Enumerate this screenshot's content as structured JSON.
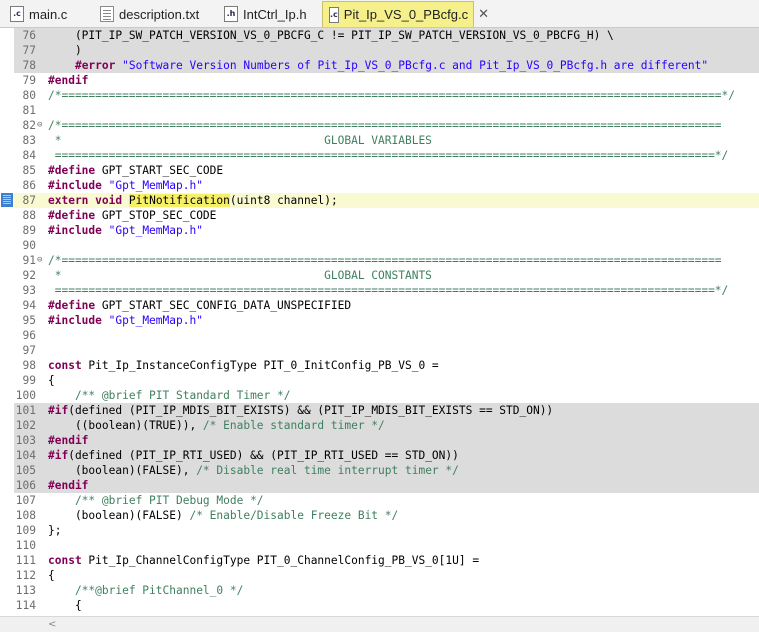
{
  "tabs": [
    {
      "label": "main.c",
      "icon": "c-file-icon",
      "active": false
    },
    {
      "label": "description.txt",
      "icon": "text-file-icon",
      "active": false
    },
    {
      "label": "IntCtrl_Ip.h",
      "icon": "h-file-icon",
      "active": false
    },
    {
      "label": "Pit_Ip_VS_0_PBcfg.c",
      "icon": "c-file-icon",
      "active": true
    }
  ],
  "close_label": "✕",
  "lines": [
    {
      "n": "76",
      "segs": [
        [
          "",
          "    (PIT_IP_SW_PATCH_VERSION_VS_0_PBCFG_C != PIT_IP_SW_PATCH_VERSION_VS_0_PBCFG_H) \\"
        ]
      ],
      "inactive": true
    },
    {
      "n": "77",
      "segs": [
        [
          "",
          "    )"
        ]
      ],
      "inactive": true
    },
    {
      "n": "78",
      "segs": [
        [
          "",
          "    "
        ],
        [
          "kw",
          "#error"
        ],
        [
          "",
          " "
        ],
        [
          "str",
          "\"Software Version Numbers of Pit_Ip_VS_0_PBcfg.c and Pit_Ip_VS_0_PBcfg.h are different\""
        ]
      ],
      "inactive": true
    },
    {
      "n": "79",
      "segs": [
        [
          "kw",
          "#endif"
        ]
      ]
    },
    {
      "n": "80",
      "segs": [
        [
          "cm",
          "/*==================================================================================================*/"
        ]
      ]
    },
    {
      "n": "81",
      "segs": []
    },
    {
      "n": "82",
      "fold": "⊖",
      "segs": [
        [
          "cm",
          "/*=================================================================================================="
        ]
      ]
    },
    {
      "n": "83",
      "segs": [
        [
          "cm",
          " *                                       GLOBAL VARIABLES"
        ]
      ]
    },
    {
      "n": "84",
      "segs": [
        [
          "cm",
          " ==================================================================================================*/"
        ]
      ]
    },
    {
      "n": "85",
      "segs": [
        [
          "kw",
          "#define"
        ],
        [
          "",
          " GPT_START_SEC_CODE"
        ]
      ]
    },
    {
      "n": "86",
      "segs": [
        [
          "kw",
          "#include"
        ],
        [
          "",
          " "
        ],
        [
          "str",
          "\"Gpt_MemMap.h\""
        ]
      ]
    },
    {
      "n": "87",
      "current": true,
      "segs": [
        [
          "kw",
          "extern"
        ],
        [
          "",
          " "
        ],
        [
          "kw",
          "void"
        ],
        [
          "",
          " "
        ],
        [
          "mark",
          "PitNotification"
        ],
        [
          "",
          "(uint8 channel);"
        ]
      ]
    },
    {
      "n": "88",
      "segs": [
        [
          "kw",
          "#define"
        ],
        [
          "",
          " GPT_STOP_SEC_CODE"
        ]
      ]
    },
    {
      "n": "89",
      "segs": [
        [
          "kw",
          "#include"
        ],
        [
          "",
          " "
        ],
        [
          "str",
          "\"Gpt_MemMap.h\""
        ]
      ]
    },
    {
      "n": "90",
      "segs": []
    },
    {
      "n": "91",
      "fold": "⊖",
      "segs": [
        [
          "cm",
          "/*=================================================================================================="
        ]
      ]
    },
    {
      "n": "92",
      "segs": [
        [
          "cm",
          " *                                       GLOBAL CONSTANTS"
        ]
      ]
    },
    {
      "n": "93",
      "segs": [
        [
          "cm",
          " ==================================================================================================*/"
        ]
      ]
    },
    {
      "n": "94",
      "segs": [
        [
          "kw",
          "#define"
        ],
        [
          "",
          " GPT_START_SEC_CONFIG_DATA_UNSPECIFIED"
        ]
      ]
    },
    {
      "n": "95",
      "segs": [
        [
          "kw",
          "#include"
        ],
        [
          "",
          " "
        ],
        [
          "str",
          "\"Gpt_MemMap.h\""
        ]
      ]
    },
    {
      "n": "96",
      "segs": []
    },
    {
      "n": "97",
      "segs": []
    },
    {
      "n": "98",
      "segs": [
        [
          "kw",
          "const"
        ],
        [
          "",
          " Pit_Ip_InstanceConfigType PIT_0_InitConfig_PB_VS_0 ="
        ]
      ]
    },
    {
      "n": "99",
      "segs": [
        [
          "",
          "{"
        ]
      ]
    },
    {
      "n": "100",
      "segs": [
        [
          "",
          "    "
        ],
        [
          "cm",
          "/** @brief PIT Standard Timer */"
        ]
      ]
    },
    {
      "n": "101",
      "inactive": true,
      "segs": [
        [
          "kw",
          "#if"
        ],
        [
          "",
          "(defined (PIT_IP_MDIS_BIT_EXISTS) && (PIT_IP_MDIS_BIT_EXISTS == STD_ON))"
        ]
      ]
    },
    {
      "n": "102",
      "inactive": true,
      "segs": [
        [
          "",
          "    ((boolean)(TRUE)), "
        ],
        [
          "cm",
          "/* Enable standard timer */"
        ]
      ]
    },
    {
      "n": "103",
      "inactive": true,
      "segs": [
        [
          "kw",
          "#endif"
        ]
      ]
    },
    {
      "n": "104",
      "inactive": true,
      "segs": [
        [
          "kw",
          "#if"
        ],
        [
          "",
          "(defined (PIT_IP_RTI_USED) && (PIT_IP_RTI_USED == STD_ON))"
        ]
      ]
    },
    {
      "n": "105",
      "inactive": true,
      "segs": [
        [
          "",
          "    (boolean)(FALSE), "
        ],
        [
          "cm",
          "/* Disable real time interrupt timer */"
        ]
      ]
    },
    {
      "n": "106",
      "inactive": true,
      "segs": [
        [
          "kw",
          "#endif"
        ]
      ]
    },
    {
      "n": "107",
      "segs": [
        [
          "",
          "    "
        ],
        [
          "cm",
          "/** @brief PIT Debug Mode */"
        ]
      ]
    },
    {
      "n": "108",
      "segs": [
        [
          "",
          "    (boolean)(FALSE) "
        ],
        [
          "cm",
          "/* Enable/Disable Freeze Bit */"
        ]
      ]
    },
    {
      "n": "109",
      "segs": [
        [
          "",
          "};"
        ]
      ]
    },
    {
      "n": "110",
      "segs": []
    },
    {
      "n": "111",
      "segs": [
        [
          "kw",
          "const"
        ],
        [
          "",
          " Pit_Ip_ChannelConfigType PIT_0_ChannelConfig_PB_VS_0[1U] ="
        ]
      ]
    },
    {
      "n": "112",
      "segs": [
        [
          "",
          "{"
        ]
      ]
    },
    {
      "n": "113",
      "segs": [
        [
          "",
          "    "
        ],
        [
          "cm",
          "/**@brief PitChannel_0 */"
        ]
      ]
    },
    {
      "n": "114",
      "segs": [
        [
          "",
          "    {"
        ]
      ]
    }
  ],
  "scroll_left_glyph": "<"
}
